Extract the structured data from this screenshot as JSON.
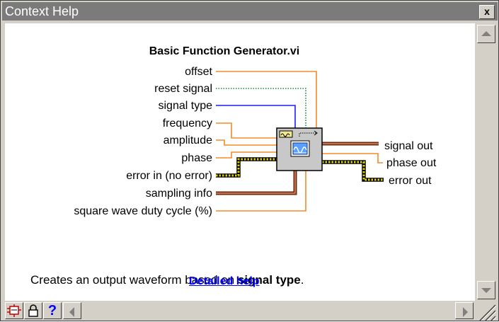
{
  "window": {
    "title": "Context Help",
    "close_label": "x"
  },
  "vi": {
    "name": "Basic Function Generator.vi",
    "inputs": [
      {
        "label": "offset",
        "wire": "orange-thin"
      },
      {
        "label": "reset signal",
        "wire": "green-dotted"
      },
      {
        "label": "signal type",
        "wire": "blue"
      },
      {
        "label": "frequency",
        "wire": "orange-thin"
      },
      {
        "label": "amplitude",
        "wire": "orange-thin"
      },
      {
        "label": "phase",
        "wire": "orange-thin"
      },
      {
        "label": "error in (no error)",
        "wire": "yellow-cluster"
      },
      {
        "label": "sampling info",
        "wire": "brown-cluster"
      },
      {
        "label": "square wave duty cycle (%)",
        "wire": "orange-thin"
      }
    ],
    "outputs": [
      {
        "label": "signal out",
        "wire": "brown-cluster"
      },
      {
        "label": "phase out",
        "wire": "orange-thin"
      },
      {
        "label": "error out",
        "wire": "yellow-cluster"
      }
    ]
  },
  "description": {
    "prefix": "Creates an output waveform based on ",
    "bold": "signal type",
    "suffix": "."
  },
  "detailed_help_link": "Detailed help",
  "toolbar": {
    "show_optional_terminals_icon": "terminal-icon",
    "lock_icon": "lock-icon",
    "help_label": "?"
  },
  "colors": {
    "orange": "#f28c28",
    "green": "#1b8a3a",
    "blue": "#1a1aff",
    "brown": "#a0522d",
    "yellow": "#c8b400",
    "link": "#0000ff",
    "titlebar": "#7b7b7b"
  }
}
